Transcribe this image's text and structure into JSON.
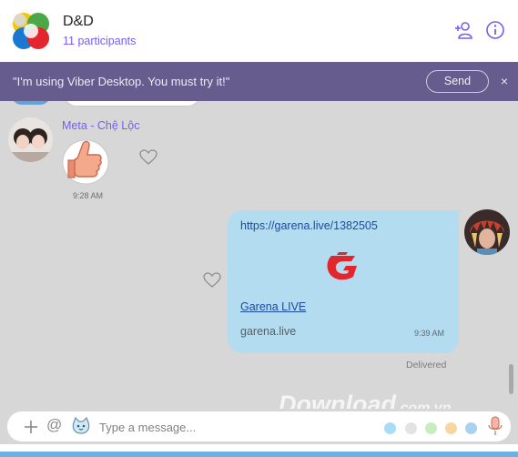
{
  "header": {
    "title": "D&D",
    "participants": "11 participants"
  },
  "banner": {
    "message": "\"I'm using Viber Desktop. You must try it!\"",
    "send_label": "Send",
    "close_label": "×"
  },
  "messages": {
    "incoming": {
      "sender": "Meta - Chệ Lộc",
      "time": "9:28 AM"
    },
    "outgoing": {
      "link": "https://garena.live/1382505",
      "preview_title": "Garena LIVE",
      "preview_domain": "garena.live",
      "time": "9:39 AM",
      "status": "Delivered"
    }
  },
  "watermark": {
    "text": "Download",
    "suffix": ".com.vn"
  },
  "composer": {
    "placeholder": "Type a message...",
    "at_symbol": "@",
    "dots_colors": [
      "#a9dcf5",
      "#e3e3e3",
      "#c7ecc0",
      "#f6d7a0",
      "#a9d1f0"
    ]
  },
  "colors": {
    "accent": "#7360f2",
    "banner": "#665c8e",
    "outgoing_bubble": "#b4dcf0",
    "chat_bg": "#d7d7d7"
  },
  "icons": {
    "add_participant": "add-participant-icon",
    "info": "info-icon",
    "like": "heart-icon",
    "attach": "plus-icon",
    "emoji": "emoji-icon",
    "mic": "mic-icon"
  }
}
